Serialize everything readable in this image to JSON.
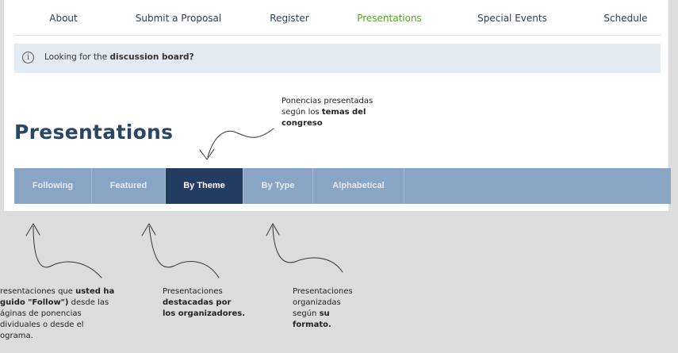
{
  "topnav": {
    "items": [
      {
        "label": "About"
      },
      {
        "label": "Submit a Proposal"
      },
      {
        "label": "Register"
      },
      {
        "label": "Presentations",
        "active": true
      },
      {
        "label": "Special Events"
      },
      {
        "label": "Schedule"
      }
    ]
  },
  "notice": {
    "text_prefix": "Looking for the ",
    "link_text": "discussion board?"
  },
  "page": {
    "title": "Presentations"
  },
  "tabs": [
    {
      "label": "Following"
    },
    {
      "label": "Featured"
    },
    {
      "label": "By Theme",
      "active": true
    },
    {
      "label": "By Type"
    },
    {
      "label": "Alphabetical"
    }
  ],
  "annotations": {
    "by_theme": {
      "line1": "Ponencias presentadas",
      "line2_prefix": "según los ",
      "bold1": "temas del",
      "bold2": "congreso"
    },
    "following": {
      "line1_prefix": "resentaciones que ",
      "line1_bold": "usted ha",
      "line2_bold": "guido \"Follow\")",
      "line2_rest": " desde las",
      "line3": "áginas de ponencias",
      "line4": "dividuales o desde el",
      "line5": "ograma."
    },
    "featured": {
      "line1": "Presentaciones",
      "bold1": "destacadas por",
      "bold2": "los organizadores."
    },
    "by_type": {
      "line1": "Presentaciones",
      "line2": "organizadas",
      "line3_prefix": "según ",
      "line3_bold": "su",
      "line4_bold": "formato."
    }
  },
  "colors": {
    "active_nav": "#5aa02c",
    "tab_bar": "#8aa4c3",
    "active_tab": "#233c60",
    "title": "#2c4563",
    "notice_bg": "#e2eaf3"
  },
  "icons": {
    "notice": "info-circle-icon"
  }
}
